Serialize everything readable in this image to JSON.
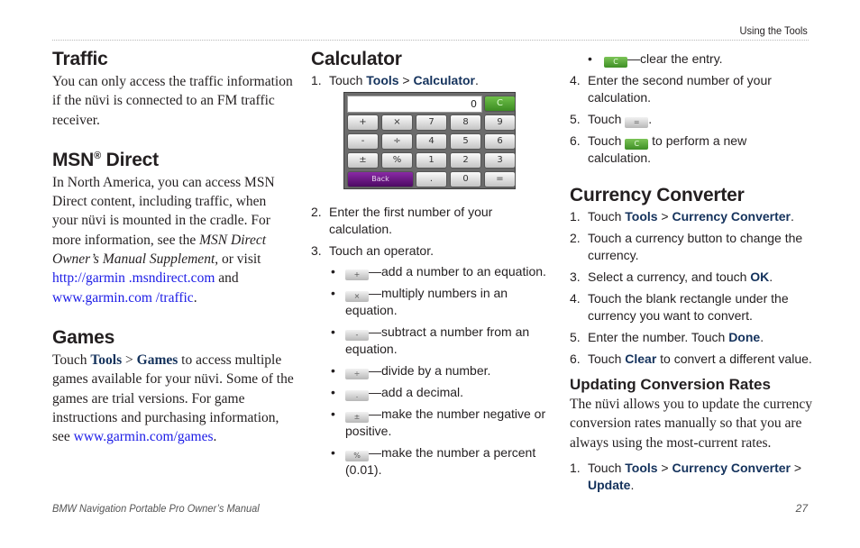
{
  "header": {
    "running_head": "Using the Tools"
  },
  "traffic": {
    "title": "Traffic",
    "body": "You can only access the traffic information if the nüvi is connected to an FM traffic receiver."
  },
  "msn": {
    "title_main": "MSN",
    "title_sup": "®",
    "title_rest": " Direct",
    "body_1": "In North America, you can access MSN Direct content, including traffic, when your nüvi is mounted in the cradle. For more information, see the ",
    "body_italic": "MSN Direct Owner’s Manual Supplement",
    "body_2": ", or visit ",
    "link_1": "http://garmin .msndirect.com",
    "body_3": " and ",
    "link_2": "www.garmin.com /traffic",
    "body_4": "."
  },
  "games": {
    "title": "Games",
    "touch": "Touch ",
    "tools": "Tools",
    "sep": " > ",
    "games": "Games",
    "body_1": " to access multiple games available for your nüvi. Some of the games are trial versions. For game instructions and purchasing information, see ",
    "link": "www.garmin.com/games",
    "body_2": "."
  },
  "calculator": {
    "title": "Calculator",
    "step1": {
      "num": "1.",
      "text": "Touch ",
      "tools": "Tools",
      "sep": " > ",
      "target": "Calculator",
      "end": "."
    },
    "screen": {
      "display_value": "0",
      "clear_label": "C",
      "keys_row1": [
        "+",
        "×",
        "7",
        "8",
        "9"
      ],
      "keys_row2": [
        "-",
        "÷",
        "4",
        "5",
        "6"
      ],
      "keys_row3": [
        "±",
        "%",
        "1",
        "2",
        "3"
      ],
      "back_label": "Back",
      "keys_row4": [
        ".",
        "0",
        "="
      ]
    },
    "step2": {
      "num": "2.",
      "text": "Enter the first number of your calculation."
    },
    "step3": {
      "num": "3.",
      "text": "Touch an operator."
    },
    "operators": [
      {
        "key": "+",
        "text": "—add a number to an equation."
      },
      {
        "key": "×",
        "text": "—multiply numbers in an equation."
      },
      {
        "key": "-",
        "text": "—subtract a number from an equation."
      },
      {
        "key": "÷",
        "text": "—divide by a number."
      },
      {
        "key": ".",
        "text": "—add a decimal."
      },
      {
        "key": "±",
        "text": "—make the number negative or positive."
      },
      {
        "key": "%",
        "text": "—make the number a percent (0.01)."
      },
      {
        "key": "C",
        "text": "—clear the entry."
      }
    ],
    "step4": {
      "num": "4.",
      "text": "Enter the second number of your calculation."
    },
    "step5": {
      "num": "5.",
      "text": "Touch ",
      "key": "=",
      "end": "."
    },
    "step6": {
      "num": "6.",
      "text": "Touch ",
      "key": "C",
      "end": " to perform a new calculation."
    }
  },
  "currency": {
    "title": "Currency Converter",
    "steps": [
      {
        "num": "1.",
        "text": "Touch ",
        "tools": "Tools",
        "sep": " > ",
        "target": "Currency Converter",
        "end": "."
      },
      {
        "num": "2.",
        "text": "Touch a currency button to change the currency."
      },
      {
        "num": "3.",
        "text": "Select a currency, and touch ",
        "target": "OK",
        "end": "."
      },
      {
        "num": "4.",
        "text": "Touch the blank rectangle under the currency you want to convert."
      },
      {
        "num": "5.",
        "text": "Enter the number. Touch ",
        "target": "Done",
        "end": "."
      },
      {
        "num": "6.",
        "text": "Touch ",
        "target": "Clear",
        "end": " to convert a different value."
      }
    ],
    "updating": {
      "title": "Updating Conversion Rates",
      "body": "The nüvi allows you to update the currency conversion rates manually so that you are always using the most-current rates.",
      "step1": {
        "num": "1.",
        "text": "Touch ",
        "tools": "Tools",
        "sep": " > ",
        "target": "Currency Converter",
        "sep2": " > ",
        "target2": "Update",
        "end": "."
      }
    }
  },
  "footer": {
    "manual_title": "BMW Navigation Portable Pro Owner’s Manual",
    "page_number": "27"
  }
}
